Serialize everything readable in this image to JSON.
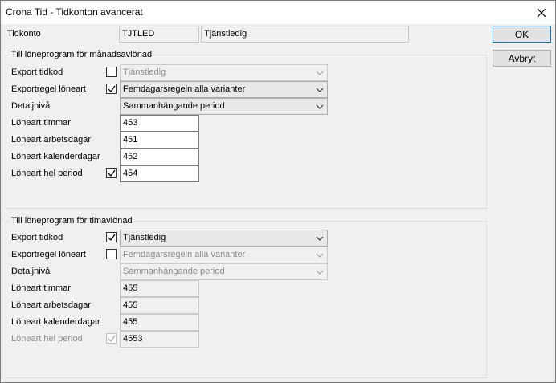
{
  "window": {
    "title": "Crona Tid - Tidkonton avancerat"
  },
  "header": {
    "tidkonto_label": "Tidkonto",
    "code": "TJTLED",
    "name": "Tjänstledig"
  },
  "buttons": {
    "ok": "OK",
    "cancel": "Avbryt"
  },
  "monthly": {
    "title": "Till löneprogram för månadsavlönad",
    "export_tidkod_label": "Export tidkod",
    "export_tidkod_checked": false,
    "export_tidkod_value": "Tjänstledig",
    "exportregel_label": "Exportregel löneart",
    "exportregel_checked": true,
    "exportregel_value": "Femdagarsregeln alla varianter",
    "detaljniva_label": "Detaljnivå",
    "detaljniva_value": "Sammanhängande period",
    "timmar_label": "Löneart timmar",
    "timmar_value": "453",
    "arbetsdagar_label": "Löneart arbetsdagar",
    "arbetsdagar_value": "451",
    "kalenderdagar_label": "Löneart kalenderdagar",
    "kalenderdagar_value": "452",
    "helperiod_label": "Löneart hel period",
    "helperiod_checked": true,
    "helperiod_value": "454"
  },
  "hourly": {
    "title": "Till löneprogram för timavlönad",
    "export_tidkod_label": "Export tidkod",
    "export_tidkod_checked": true,
    "export_tidkod_value": "Tjänstledig",
    "exportregel_label": "Exportregel löneart",
    "exportregel_checked": false,
    "exportregel_value": "Femdagarsregeln alla varianter",
    "detaljniva_label": "Detaljnivå",
    "detaljniva_value": "Sammanhängande period",
    "timmar_label": "Löneart timmar",
    "timmar_value": "455",
    "arbetsdagar_label": "Löneart arbetsdagar",
    "arbetsdagar_value": "455",
    "kalenderdagar_label": "Löneart kalenderdagar",
    "kalenderdagar_value": "455",
    "helperiod_label": "Löneart hel period",
    "helperiod_checked": true,
    "helperiod_value": "4553"
  }
}
